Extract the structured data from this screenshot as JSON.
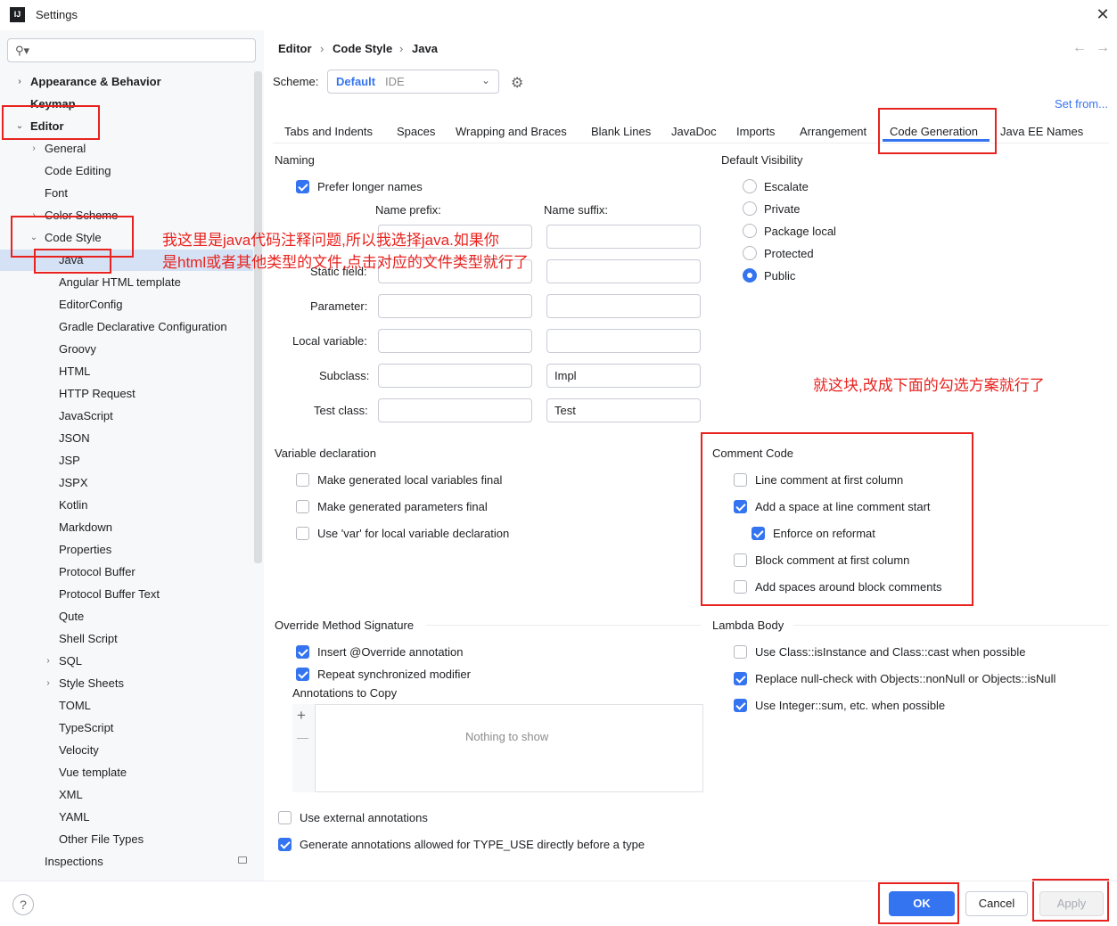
{
  "window": {
    "title": "Settings",
    "app_icon": "IJ"
  },
  "search": {
    "placeholder": ""
  },
  "sidebar": {
    "items": [
      {
        "label": "Appearance & Behavior"
      },
      {
        "label": "Keymap"
      },
      {
        "label": "Editor"
      },
      {
        "label": "General"
      },
      {
        "label": "Code Editing"
      },
      {
        "label": "Font"
      },
      {
        "label": "Color Scheme"
      },
      {
        "label": "Code Style"
      },
      {
        "label": "Java"
      },
      {
        "label": "Angular HTML template"
      },
      {
        "label": "EditorConfig"
      },
      {
        "label": "Gradle Declarative Configuration"
      },
      {
        "label": "Groovy"
      },
      {
        "label": "HTML"
      },
      {
        "label": "HTTP Request"
      },
      {
        "label": "JavaScript"
      },
      {
        "label": "JSON"
      },
      {
        "label": "JSP"
      },
      {
        "label": "JSPX"
      },
      {
        "label": "Kotlin"
      },
      {
        "label": "Markdown"
      },
      {
        "label": "Properties"
      },
      {
        "label": "Protocol Buffer"
      },
      {
        "label": "Protocol Buffer Text"
      },
      {
        "label": "Qute"
      },
      {
        "label": "Shell Script"
      },
      {
        "label": "SQL"
      },
      {
        "label": "Style Sheets"
      },
      {
        "label": "TOML"
      },
      {
        "label": "TypeScript"
      },
      {
        "label": "Velocity"
      },
      {
        "label": "Vue template"
      },
      {
        "label": "XML"
      },
      {
        "label": "YAML"
      },
      {
        "label": "Other File Types"
      },
      {
        "label": "Inspections"
      }
    ]
  },
  "breadcrumb": {
    "items": [
      "Editor",
      "Code Style",
      "Java"
    ],
    "sep": "›",
    "back": "←",
    "forward": "→"
  },
  "scheme": {
    "label": "Scheme:",
    "value": "Default",
    "suffix": "IDE",
    "set_from": "Set from..."
  },
  "tabs": [
    "Tabs and Indents",
    "Spaces",
    "Wrapping and Braces",
    "Blank Lines",
    "JavaDoc",
    "Imports",
    "Arrangement",
    "Code Generation",
    "Java EE Names"
  ],
  "naming": {
    "title": "Naming",
    "prefer_longer": "Prefer longer names",
    "prefix_header": "Name prefix:",
    "suffix_header": "Name suffix:",
    "rows": [
      {
        "label": "",
        "prefix": "",
        "suffix": ""
      },
      {
        "label": "Static field:",
        "prefix": "",
        "suffix": ""
      },
      {
        "label": "Parameter:",
        "prefix": "",
        "suffix": ""
      },
      {
        "label": "Local variable:",
        "prefix": "",
        "suffix": ""
      },
      {
        "label": "Subclass:",
        "prefix": "",
        "suffix": "Impl"
      },
      {
        "label": "Test class:",
        "prefix": "",
        "suffix": "Test"
      }
    ]
  },
  "visibility": {
    "title": "Default Visibility",
    "options": [
      "Escalate",
      "Private",
      "Package local",
      "Protected",
      "Public"
    ],
    "selected": "Public"
  },
  "variable_decl": {
    "title": "Variable declaration",
    "options": [
      "Make generated local variables final",
      "Make generated parameters final",
      "Use 'var' for local variable declaration"
    ]
  },
  "comment_code": {
    "title": "Comment Code",
    "options": [
      "Line comment at first column",
      "Add a space at line comment start",
      "Enforce on reformat",
      "Block comment at first column",
      "Add spaces around block comments"
    ]
  },
  "override": {
    "title": "Override Method Signature",
    "options": [
      "Insert @Override annotation",
      "Repeat synchronized modifier"
    ],
    "annotations_label": "Annotations to Copy",
    "add": "+",
    "remove": "—",
    "empty": "Nothing to show"
  },
  "lambda": {
    "title": "Lambda Body",
    "options": [
      "Use Class::isInstance and Class::cast when possible",
      "Replace null-check with Objects::nonNull or Objects::isNull",
      "Use Integer::sum, etc. when possible"
    ]
  },
  "external": {
    "options": [
      "Use external annotations",
      "Generate annotations allowed for TYPE_USE directly before a type"
    ]
  },
  "notes": {
    "note1_line1": "我这里是java代码注释问题,所以我选择java.如果你",
    "note1_line2": "是html或者其他类型的文件,点击对应的文件类型就行了",
    "note2": "就这块,改成下面的勾选方案就行了"
  },
  "footer": {
    "help": "?",
    "ok": "OK",
    "cancel": "Cancel",
    "apply": "Apply"
  },
  "colors": {
    "accent": "#3574f0",
    "annotation": "#e8231f",
    "selection": "#d5e1f5"
  }
}
